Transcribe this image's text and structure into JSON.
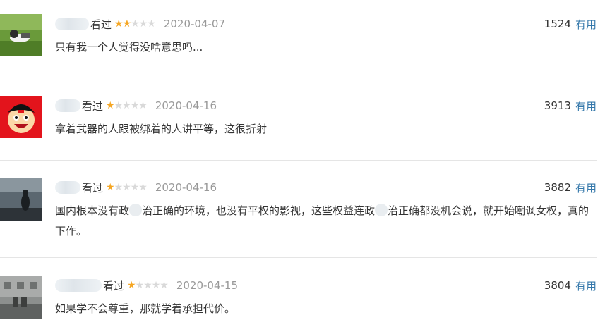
{
  "comments": [
    {
      "status": "看过",
      "rating": 2,
      "date": "2020-04-07",
      "votes": "1524",
      "useful": "有用",
      "text": "只有我一个人觉得没啥意思吗..."
    },
    {
      "status": "看过",
      "rating": 1,
      "date": "2020-04-16",
      "votes": "3913",
      "useful": "有用",
      "text": "拿着武器的人跟被绑着的人讲平等，这很折射"
    },
    {
      "status": "看过",
      "rating": 1,
      "date": "2020-04-16",
      "votes": "3882",
      "useful": "有用",
      "text_parts": [
        "国内根本没有政",
        "治正确的环境，也没有平权的影视，这些权益连政",
        "治正确都没机会说，就开始嘲讽女权，真的下作。"
      ]
    },
    {
      "status": "看过",
      "rating": 1,
      "date": "2020-04-15",
      "votes": "3804",
      "useful": "有用",
      "text": "如果学不会尊重，那就学着承担代价。"
    }
  ],
  "colors": {
    "star_on": "#f5a623",
    "star_off": "#d9d9d9",
    "link": "#3377aa",
    "date": "#999999",
    "divider": "#e5e5e5"
  },
  "icons": {
    "star": "star-icon"
  }
}
